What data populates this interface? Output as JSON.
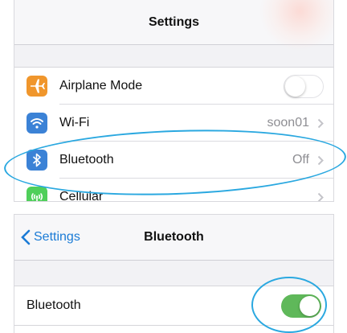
{
  "settings": {
    "title": "Settings",
    "rows": [
      {
        "label": "Airplane Mode",
        "icon": "airplane-icon",
        "color": "#f0962c",
        "toggle": "off"
      },
      {
        "label": "Wi-Fi",
        "icon": "wifi-icon",
        "color": "#3b82d6",
        "value": "soon01"
      },
      {
        "label": "Bluetooth",
        "icon": "bluetooth-icon",
        "color": "#3b82d6",
        "value": "Off"
      },
      {
        "label": "Cellular",
        "icon": "cellular-icon",
        "color": "#4fcf5a"
      }
    ]
  },
  "bluetooth_screen": {
    "back_label": "Settings",
    "title": "Bluetooth",
    "row_label": "Bluetooth",
    "toggle": "on"
  },
  "colors": {
    "accent": "#1b7bd6",
    "highlight_ellipse": "#2aa8e0",
    "toggle_on": "#5fb85a"
  }
}
